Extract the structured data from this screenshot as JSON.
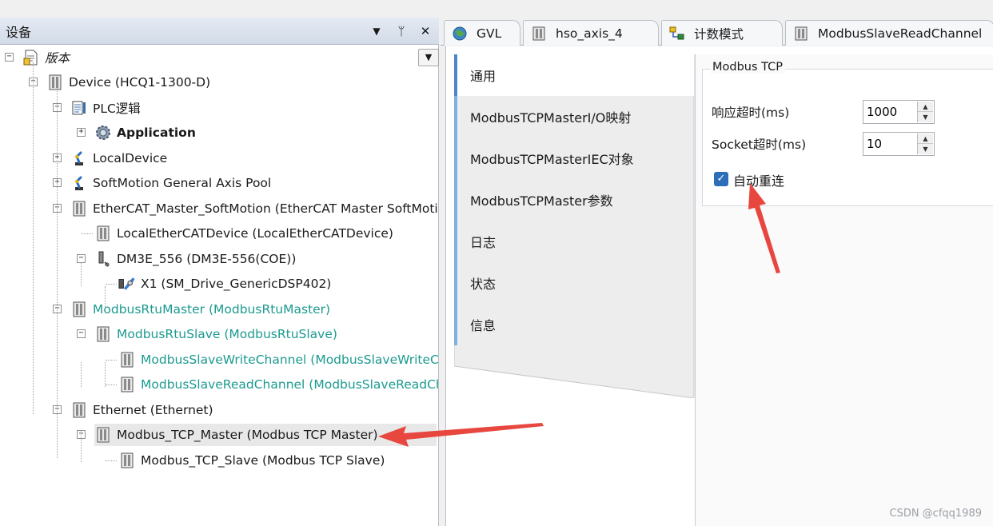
{
  "devices_panel": {
    "title": "设备",
    "controls": {
      "dropdown": "▼",
      "pin": "ᛘ",
      "close": "✕"
    },
    "scroll_down": "▼",
    "tree": [
      {
        "label": "版本",
        "style": "italic",
        "icon": "document-icon",
        "expander": "−"
      },
      {
        "label": "Device (HCQ1-1300-D)",
        "style": "normal",
        "icon": "device-icon",
        "expander": "−"
      },
      {
        "label": "PLC逻辑",
        "style": "normal",
        "icon": "plc-logic-icon",
        "expander": "−"
      },
      {
        "label": "Application",
        "style": "bold",
        "icon": "gear-icon",
        "expander": "+"
      },
      {
        "label": "LocalDevice",
        "style": "normal",
        "icon": "robot-arm-icon",
        "expander": "+"
      },
      {
        "label": "SoftMotion General Axis Pool",
        "style": "normal",
        "icon": "robot-arm-icon",
        "expander": "+"
      },
      {
        "label": "EtherCAT_Master_SoftMotion (EtherCAT Master SoftMoti…",
        "style": "normal",
        "icon": "device-icon",
        "expander": "−"
      },
      {
        "label": "LocalEtherCATDevice (LocalEtherCATDevice)",
        "style": "normal",
        "icon": "device-icon",
        "expander": ""
      },
      {
        "label": "DM3E_556 (DM3E-556(COE))",
        "style": "normal",
        "icon": "drive-icon",
        "expander": "−"
      },
      {
        "label": "X1 (SM_Drive_GenericDSP402)",
        "style": "normal",
        "icon": "axis-icon",
        "expander": ""
      },
      {
        "label": "ModbusRtuMaster (ModbusRtuMaster)",
        "style": "teal",
        "icon": "device-icon",
        "expander": "−"
      },
      {
        "label": "ModbusRtuSlave (ModbusRtuSlave)",
        "style": "teal",
        "icon": "device-icon",
        "expander": "−"
      },
      {
        "label": "ModbusSlaveWriteChannel (ModbusSlaveWriteChan",
        "style": "teal",
        "icon": "device-icon",
        "expander": ""
      },
      {
        "label": "ModbusSlaveReadChannel (ModbusSlaveReadChan",
        "style": "teal",
        "icon": "device-icon",
        "expander": ""
      },
      {
        "label": "Ethernet (Ethernet)",
        "style": "normal",
        "icon": "device-icon",
        "expander": "−"
      },
      {
        "label": "Modbus_TCP_Master (Modbus TCP Master)",
        "style": "normal",
        "icon": "device-icon",
        "expander": "−"
      },
      {
        "label": "Modbus_TCP_Slave (Modbus TCP Slave)",
        "style": "normal",
        "icon": "device-icon",
        "expander": ""
      }
    ]
  },
  "editor_tabs": [
    {
      "label": "GVL",
      "icon": "globe-icon"
    },
    {
      "label": "hso_axis_4",
      "icon": "device-icon"
    },
    {
      "label": "计数模式",
      "icon": "diagram-icon"
    },
    {
      "label": "ModbusSlaveReadChannel",
      "icon": "device-icon"
    }
  ],
  "config_tabs": [
    {
      "label": "通用",
      "active": true
    },
    {
      "label": "ModbusTCPMasterI/O映射",
      "active": false
    },
    {
      "label": "ModbusTCPMasterIEC对象",
      "active": false
    },
    {
      "label": "ModbusTCPMaster参数",
      "active": false
    },
    {
      "label": "日志",
      "active": false
    },
    {
      "label": "状态",
      "active": false
    },
    {
      "label": "信息",
      "active": false
    }
  ],
  "modbus_tcp": {
    "group_title": "Modbus TCP",
    "response_timeout_label": "响应超时(ms)",
    "response_timeout_value": "1000",
    "socket_timeout_label": "Socket超时(ms)",
    "socket_timeout_value": "10",
    "auto_reconnect_label": "自动重连",
    "auto_reconnect_checked": true,
    "checkmark": "✓",
    "spin_up": "▲",
    "spin_down": "▼"
  },
  "watermark": "CSDN @cfqq1989",
  "colors": {
    "teal_text": "#1b9a8f",
    "accent_blue": "#4a86c8",
    "annotation_arrow": "#e8473f"
  }
}
